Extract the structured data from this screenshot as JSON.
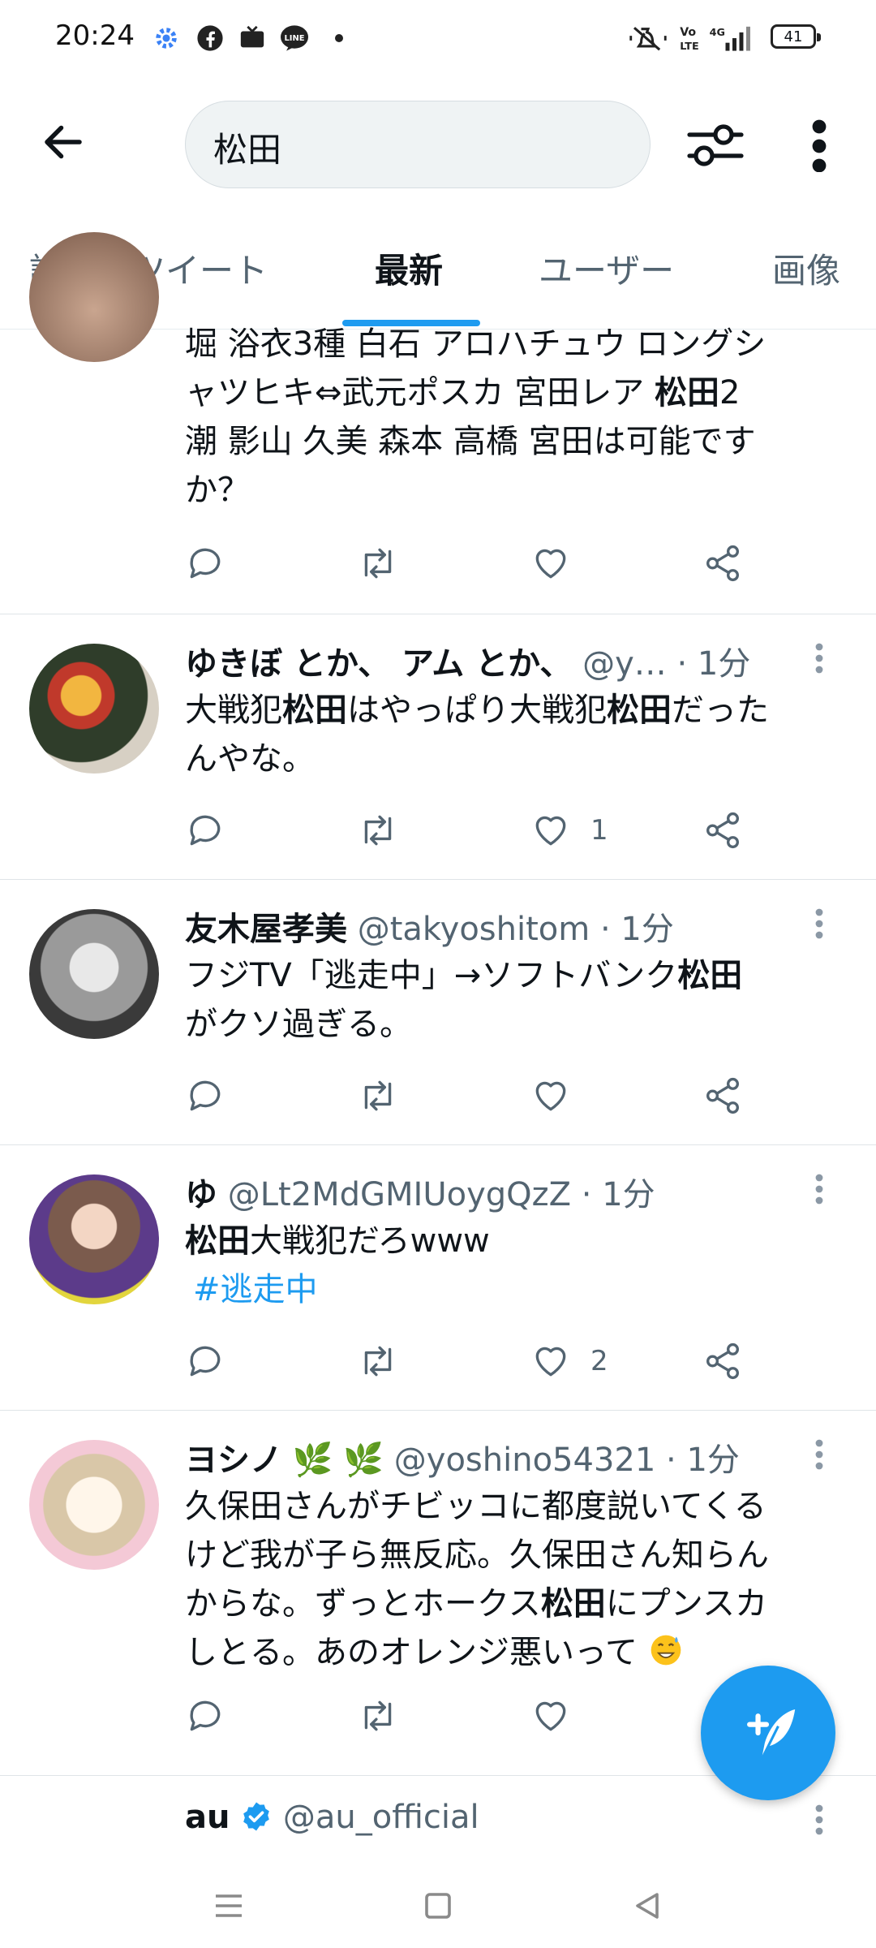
{
  "status_bar": {
    "time": "20:24",
    "notification_icons": [
      "gear-icon",
      "facebook-icon",
      "tv-icon",
      "line-icon",
      "dot-icon"
    ],
    "right_icons": [
      "mute-icon",
      "volte-icon",
      "signal-4g-icon"
    ],
    "battery": "41"
  },
  "header": {
    "search_value": "松田",
    "icons": [
      "back-arrow-icon",
      "filter-icon",
      "more-vertical-icon"
    ]
  },
  "tabs": [
    {
      "label": "話題のツイート",
      "active": false
    },
    {
      "label": "最新",
      "active": true
    },
    {
      "label": "ユーザー",
      "active": false
    },
    {
      "label": "画像",
      "active": false
    }
  ],
  "colors": {
    "accent": "#1d9bf0",
    "text": "#0f1419",
    "secondary": "#536471"
  },
  "tweets": [
    {
      "name": "",
      "handle": "",
      "time": "",
      "body_lines": [
        "堀 浴衣3種 白石 アロハチュウ ロングシ",
        "ャツヒキ⇔武元ポスカ 宮田レア ",
        "松田",
        "2",
        "潮 影山 久美 森本 高橋 宮田は可能です",
        "か？"
      ],
      "like_count": ""
    },
    {
      "name": "ゆきぼ とか、 アム とか、",
      "handle": "@y…",
      "time": "· 1分",
      "body_parts": [
        "大戦犯",
        "松田",
        "はやっぱり大戦犯",
        "松田",
        "だった",
        "んやな。"
      ],
      "like_count": "1"
    },
    {
      "name": "友木屋孝美",
      "handle": "@takyoshitom",
      "time": "· 1分",
      "body_parts": [
        "フジTV「逃走中」→ソフトバンク",
        "松田",
        "がクソ過ぎる。"
      ],
      "like_count": ""
    },
    {
      "name": "ゆ",
      "handle": "@Lt2MdGMIUoygQzZ",
      "time": "· 1分",
      "body_parts": [
        "松田",
        "大戦犯だろwww"
      ],
      "hashtag": "#逃走中",
      "like_count": "2"
    },
    {
      "name": "ヨシノ",
      "name_emoji": "🌿 🌿",
      "handle": "@yoshino54321",
      "time": "· 1分",
      "body_parts": [
        "久保田さんがチビッコに都度説いてくる",
        "けど我が子ら無反応。久保田さん知らん",
        "からな。ずっとホークス",
        "松田",
        "にプンスカ",
        "しとる。あのオレンジ悪いって"
      ],
      "like_count": ""
    },
    {
      "name": "au",
      "handle": "@au_official",
      "time": "",
      "verified": true
    }
  ]
}
